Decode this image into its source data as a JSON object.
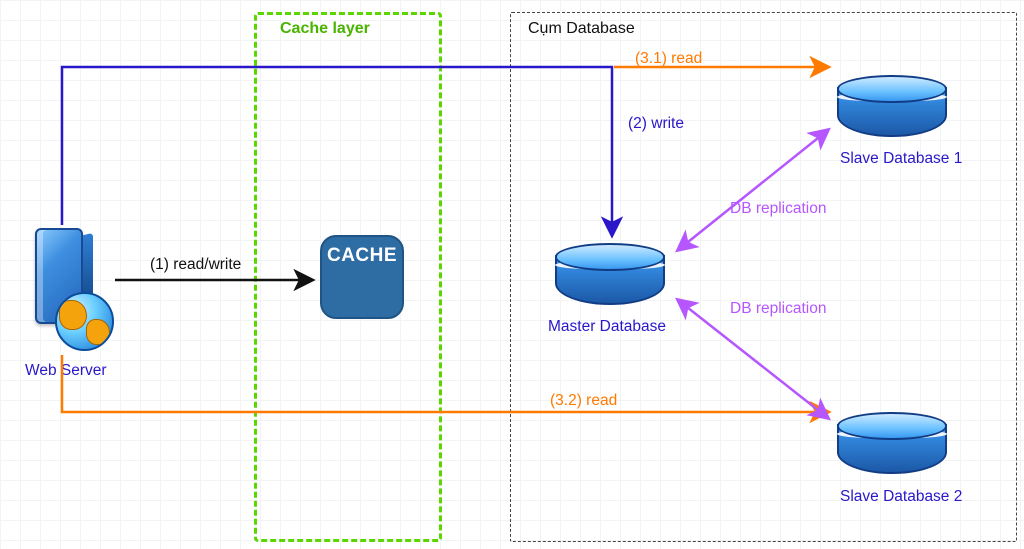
{
  "regions": {
    "cache_title": "Cache layer",
    "db_title": "Cụm Database"
  },
  "nodes": {
    "web_server": "Web Server",
    "cache": "CACHE",
    "master_db": "Master Database",
    "slave_db_1": "Slave Database 1",
    "slave_db_2": "Slave Database 2"
  },
  "edges": {
    "read_write": "(1) read/write",
    "write": "(2) write",
    "read_1": "(3.1) read",
    "read_2": "(3.2) read",
    "replication": "DB replication"
  },
  "chart_data": {
    "type": "diagram",
    "title": "Web server with cache layer and master-slave database replication",
    "nodes": [
      {
        "id": "web_server",
        "label": "Web Server",
        "kind": "server"
      },
      {
        "id": "cache",
        "label": "CACHE",
        "kind": "cache",
        "group": "Cache layer"
      },
      {
        "id": "master_db",
        "label": "Master Database",
        "kind": "database",
        "group": "Cụm Database"
      },
      {
        "id": "slave_db_1",
        "label": "Slave Database 1",
        "kind": "database",
        "group": "Cụm Database"
      },
      {
        "id": "slave_db_2",
        "label": "Slave Database 2",
        "kind": "database",
        "group": "Cụm Database"
      }
    ],
    "edges": [
      {
        "from": "web_server",
        "to": "cache",
        "label": "(1) read/write",
        "color": "black",
        "style": "unidirectional"
      },
      {
        "from": "web_server",
        "to": "master_db",
        "label": "(2) write",
        "color": "blue",
        "style": "unidirectional"
      },
      {
        "from": "web_server",
        "to": "slave_db_1",
        "label": "(3.1) read",
        "color": "orange",
        "style": "unidirectional"
      },
      {
        "from": "web_server",
        "to": "slave_db_2",
        "label": "(3.2) read",
        "color": "orange",
        "style": "unidirectional"
      },
      {
        "from": "master_db",
        "to": "slave_db_1",
        "label": "DB replication",
        "color": "purple",
        "style": "bidirectional"
      },
      {
        "from": "master_db",
        "to": "slave_db_2",
        "label": "DB replication",
        "color": "purple",
        "style": "bidirectional"
      }
    ],
    "groups": [
      {
        "id": "cache_layer",
        "label": "Cache layer",
        "members": [
          "cache"
        ]
      },
      {
        "id": "db_cluster",
        "label": "Cụm Database",
        "members": [
          "master_db",
          "slave_db_1",
          "slave_db_2"
        ]
      }
    ]
  }
}
